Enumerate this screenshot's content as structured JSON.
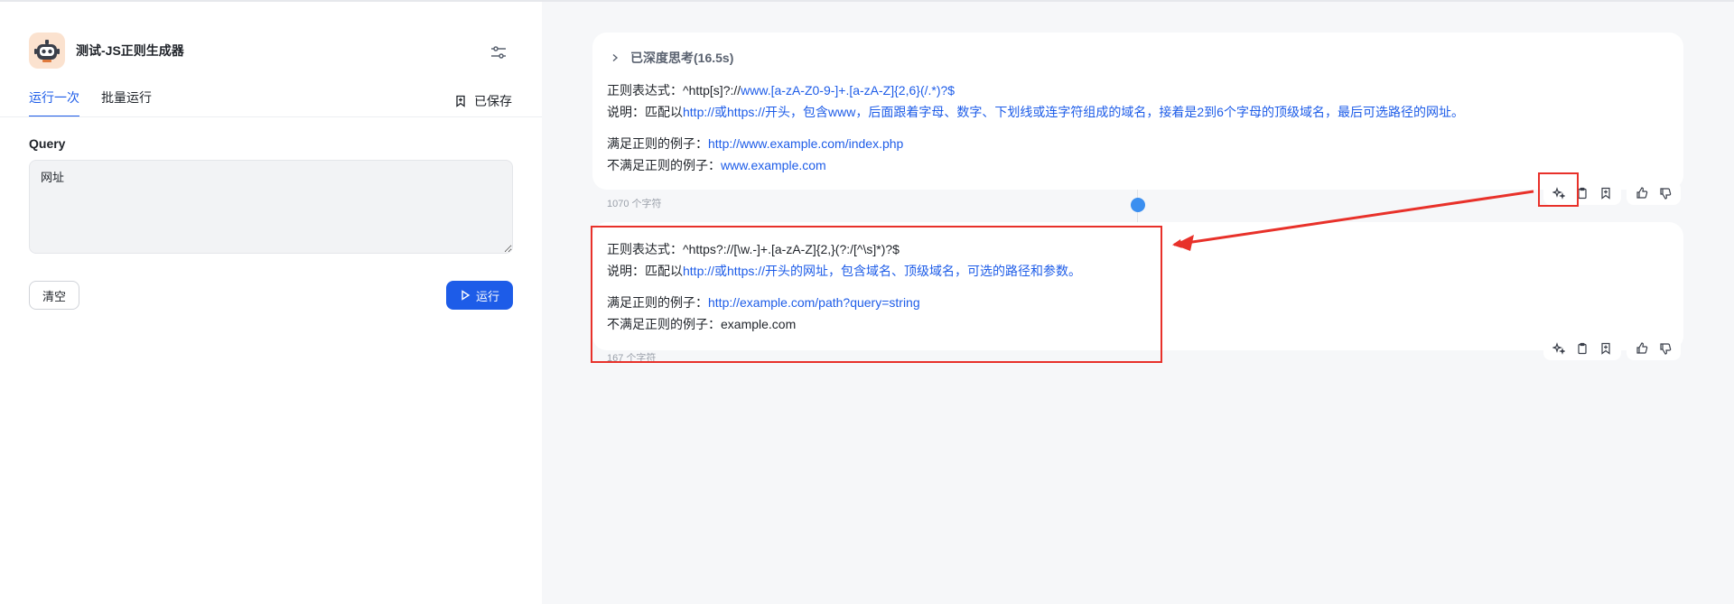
{
  "app": {
    "title": "测试-JS正则生成器",
    "accent_color": "#1d5ce8",
    "annotation_color": "#e8312a"
  },
  "tabs": [
    {
      "label": "运行一次",
      "active": true
    },
    {
      "label": "批量运行",
      "active": false
    }
  ],
  "saved_label": "已保存",
  "form": {
    "query_label": "Query",
    "query_value": "网址",
    "clear_label": "清空",
    "run_label": "运行"
  },
  "results": [
    {
      "thinking_label": "已深度思考(16.5s)",
      "regex_prefix": "正则表达式：^http[s]?://",
      "regex_link": "www.[a-zA-Z0-9-]+.[a-zA-Z]{2,6}(/.*)?$",
      "desc_prefix": "说明：匹配以",
      "desc_link": "http://或https://开头，包含www，后面跟着字母、数字、下划线或连字符组成的域名，接着是2到6个字母的顶级域名，最后可选路径的网址。",
      "match_prefix": "满足正则的例子：",
      "match_value": "http://www.example.com/index.php",
      "nomatch_prefix": "不满足正则的例子：",
      "nomatch_value": "www.example.com",
      "char_count": "1070 个字符"
    },
    {
      "regex_prefix": "正则表达式：^https?://[\\w.-]+.[a-zA-Z]{2,}(?:/[^\\s]*)?$",
      "desc_prefix": "说明：匹配以",
      "desc_link": "http://或https://开头的网址，包含域名、顶级域名，可选的路径和参数。",
      "match_prefix": "满足正则的例子：",
      "match_value": "http://example.com/path?query=string",
      "nomatch_prefix": "不满足正则的例子：",
      "nomatch_value": "example.com",
      "char_count": "167 个字符"
    }
  ],
  "icons": {
    "settings": "sliders-icon",
    "saved": "bookmark-icon",
    "run": "play-icon",
    "think": "chevron-right-icon",
    "actions": [
      "sparkle-icon",
      "clipboard-icon",
      "bookmark-icon",
      "thumbs-up-icon",
      "thumbs-down-icon"
    ]
  }
}
